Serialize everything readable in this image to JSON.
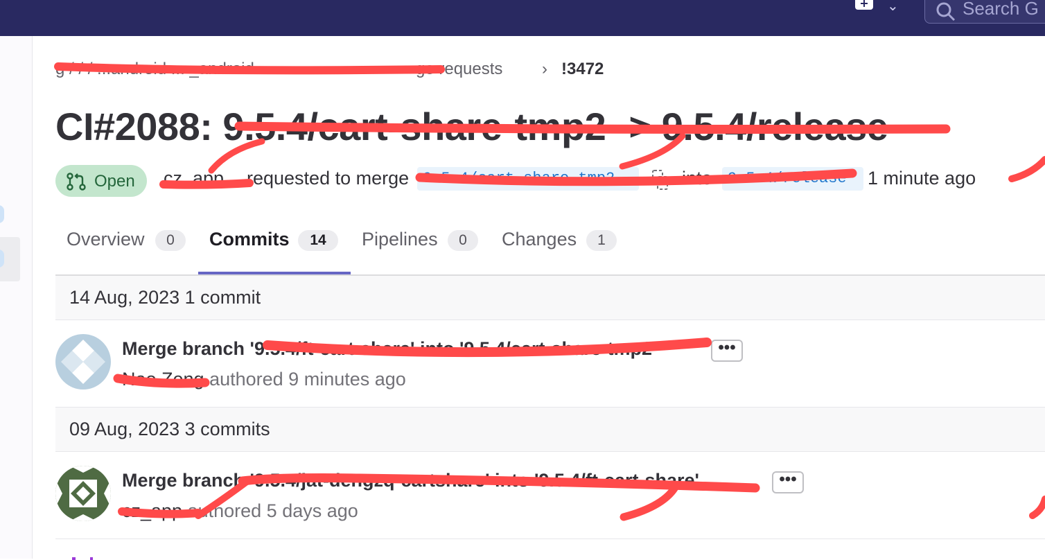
{
  "topbar": {
    "search_placeholder": "Search G",
    "icons": [
      "plus-square-icon",
      "chevron-down-icon",
      "search-icon"
    ]
  },
  "breadcrumb": {
    "path_label": "g  /  /  /  ...android  ... _android  ",
    "path_tail": "ge requests",
    "current": "!3472"
  },
  "merge_request": {
    "title": "CI#2088: 9.5.4/cart-share-tmp2 -> 9.5.4/release",
    "status": "Open",
    "author": "cz_app",
    "requested_text": "requested to merge",
    "source_branch": "9.5.4/cart-share-tmp2",
    "into_text": "into",
    "target_branch": "9.5.4/release",
    "time": "1 minute ago"
  },
  "tabs": [
    {
      "label": "Overview",
      "count": "0"
    },
    {
      "label": "Commits",
      "count": "14"
    },
    {
      "label": "Pipelines",
      "count": "0"
    },
    {
      "label": "Changes",
      "count": "1"
    }
  ],
  "commit_groups": [
    {
      "header": "14 Aug, 2023 1 commit",
      "commits": [
        {
          "title": "Merge branch '9.5.4/ft-cart-share' into '9.5.4/cart-share-tmp2'",
          "author": "Nao Zeng",
          "meta": "authored 9 minutes ago",
          "more_label": "•••"
        }
      ]
    },
    {
      "header": "09 Aug, 2023 3 commits",
      "commits": [
        {
          "title": "Merge branch '9.5.4/jat-dengzq-cartshare' into '9.5.4/ft-cart-share'",
          "author": "cz_app",
          "meta": "authored 5 days ago",
          "more_label": "•••"
        }
      ]
    }
  ],
  "colors": {
    "navbar": "#292961",
    "open_badge_bg": "#c3e6cd",
    "open_badge_text": "#24663b",
    "branch_chip_bg": "#e9f3fc",
    "branch_chip_text": "#1f75cb",
    "tab_underline": "#6666c4",
    "redaction": "#ff4a4a"
  }
}
